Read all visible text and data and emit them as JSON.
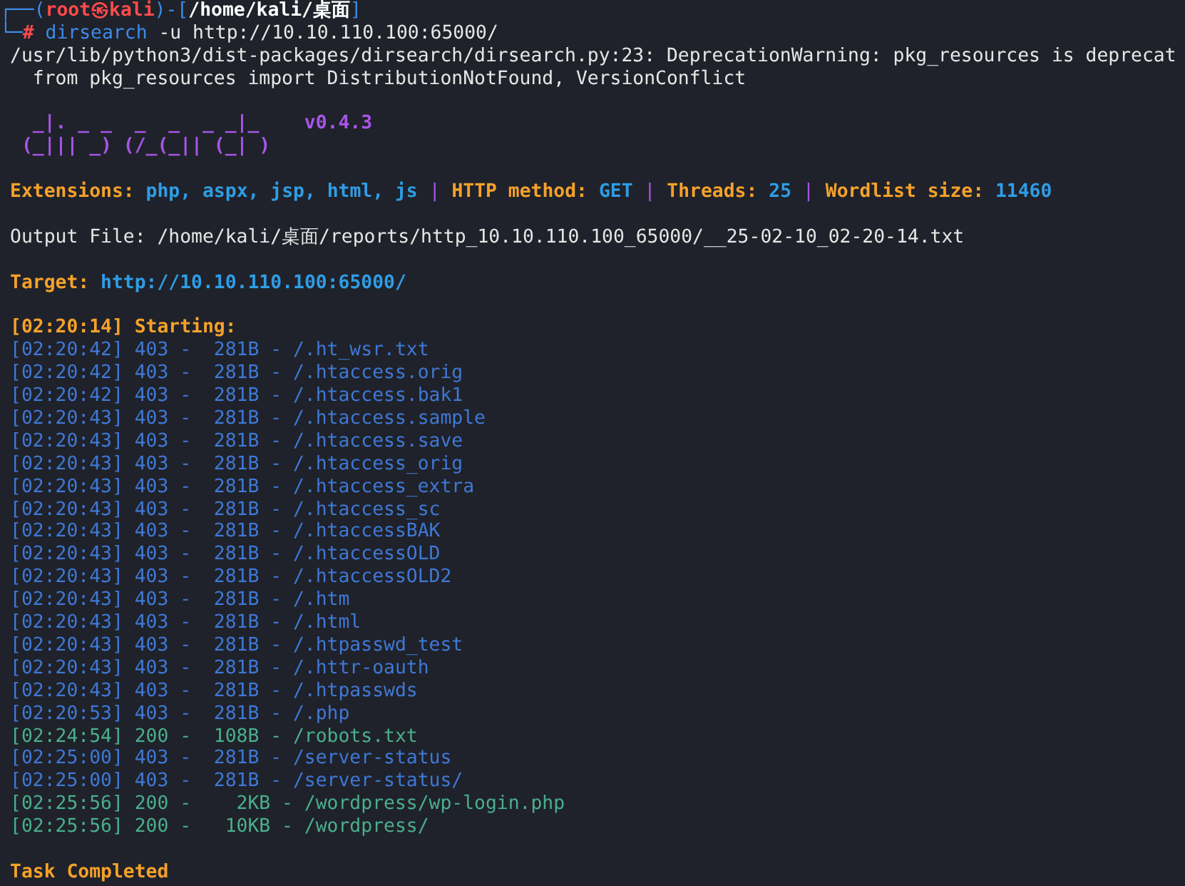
{
  "prompt": {
    "frame_open": "┌──(",
    "frame_mid": ")-[",
    "frame_close": "]",
    "frame_low": "└─",
    "user": "root",
    "at": "㉿",
    "host": "kali",
    "path": "/home/kali/桌面",
    "symbol": "#",
    "command": "dirsearch",
    "args": "-u http://10.10.110.100:65000/"
  },
  "warning_lines": [
    "/usr/lib/python3/dist-packages/dirsearch/dirsearch.py:23: DeprecationWarning: pkg_resources is deprecat",
    "  from pkg_resources import DistributionNotFound, VersionConflict"
  ],
  "banner": [
    "  _|. _ _  _  _  _ _|_    v0.4.3",
    " (_||| _) (/_(_|| (_| )"
  ],
  "config": {
    "separator": "|",
    "items": [
      {
        "label": "Extensions:",
        "value": "php, aspx, jsp, html, js"
      },
      {
        "label": "HTTP method:",
        "value": "GET"
      },
      {
        "label": "Threads:",
        "value": "25"
      },
      {
        "label": "Wordlist size:",
        "value": "11460"
      }
    ]
  },
  "output_file": "Output File: /home/kali/桌面/reports/http_10.10.110.100_65000/__25-02-10_02-20-14.txt",
  "target": {
    "label": "Target:",
    "value": "http://10.10.110.100:65000/"
  },
  "start": "[02:20:14] Starting:",
  "results": [
    {
      "text": "[02:20:42] 403 -  281B - /.ht_wsr.txt",
      "kind": "forbidden"
    },
    {
      "text": "[02:20:42] 403 -  281B - /.htaccess.orig",
      "kind": "forbidden"
    },
    {
      "text": "[02:20:42] 403 -  281B - /.htaccess.bak1",
      "kind": "forbidden"
    },
    {
      "text": "[02:20:43] 403 -  281B - /.htaccess.sample",
      "kind": "forbidden"
    },
    {
      "text": "[02:20:43] 403 -  281B - /.htaccess.save",
      "kind": "forbidden"
    },
    {
      "text": "[02:20:43] 403 -  281B - /.htaccess_orig",
      "kind": "forbidden"
    },
    {
      "text": "[02:20:43] 403 -  281B - /.htaccess_extra",
      "kind": "forbidden"
    },
    {
      "text": "[02:20:43] 403 -  281B - /.htaccess_sc",
      "kind": "forbidden"
    },
    {
      "text": "[02:20:43] 403 -  281B - /.htaccessBAK",
      "kind": "forbidden"
    },
    {
      "text": "[02:20:43] 403 -  281B - /.htaccessOLD",
      "kind": "forbidden"
    },
    {
      "text": "[02:20:43] 403 -  281B - /.htaccessOLD2",
      "kind": "forbidden"
    },
    {
      "text": "[02:20:43] 403 -  281B - /.htm",
      "kind": "forbidden"
    },
    {
      "text": "[02:20:43] 403 -  281B - /.html",
      "kind": "forbidden"
    },
    {
      "text": "[02:20:43] 403 -  281B - /.htpasswd_test",
      "kind": "forbidden"
    },
    {
      "text": "[02:20:43] 403 -  281B - /.httr-oauth",
      "kind": "forbidden"
    },
    {
      "text": "[02:20:43] 403 -  281B - /.htpasswds",
      "kind": "forbidden"
    },
    {
      "text": "[02:20:53] 403 -  281B - /.php",
      "kind": "forbidden"
    },
    {
      "text": "[02:24:54] 200 -  108B - /robots.txt",
      "kind": "ok"
    },
    {
      "text": "[02:25:00] 403 -  281B - /server-status",
      "kind": "forbidden"
    },
    {
      "text": "[02:25:00] 403 -  281B - /server-status/",
      "kind": "forbidden"
    },
    {
      "text": "[02:25:56] 200 -    2KB - /wordpress/wp-login.php",
      "kind": "ok"
    },
    {
      "text": "[02:25:56] 200 -   10KB - /wordpress/",
      "kind": "ok"
    }
  ],
  "footer": "Task Completed"
}
